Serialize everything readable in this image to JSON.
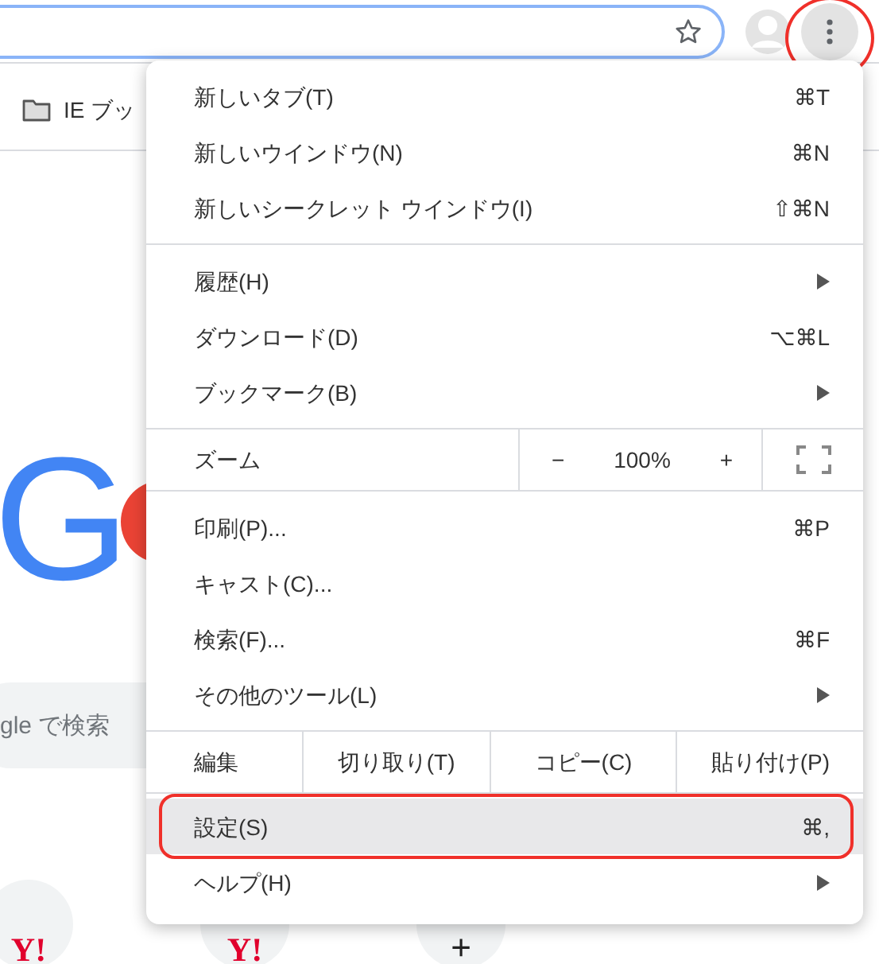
{
  "toolbar": {
    "menu_button": {
      "callout": true
    }
  },
  "bookmarks": [
    {
      "label": "IE ブッ"
    }
  ],
  "logo": {
    "text": "G"
  },
  "search": {
    "placeholder": "gle で検索"
  },
  "shortcuts": [
    {
      "kind": "site",
      "label": "Y!"
    },
    {
      "kind": "site",
      "label": "Y!"
    },
    {
      "kind": "add",
      "label": "+"
    }
  ],
  "menu": {
    "sections": [
      {
        "kind": "items",
        "items": [
          {
            "label": "新しいタブ(T)",
            "shortcut": "⌘T",
            "submenu": false,
            "selected": false,
            "callout": false
          },
          {
            "label": "新しいウインドウ(N)",
            "shortcut": "⌘N",
            "submenu": false,
            "selected": false,
            "callout": false
          },
          {
            "label": "新しいシークレット ウインドウ(I)",
            "shortcut": "⇧⌘N",
            "submenu": false,
            "selected": false,
            "callout": false
          }
        ]
      },
      {
        "kind": "items",
        "items": [
          {
            "label": "履歴(H)",
            "submenu": true,
            "selected": false,
            "callout": false
          },
          {
            "label": "ダウンロード(D)",
            "shortcut": "⌥⌘L",
            "submenu": false,
            "selected": false,
            "callout": false
          },
          {
            "label": "ブックマーク(B)",
            "submenu": true,
            "selected": false,
            "callout": false
          }
        ]
      },
      {
        "kind": "zoom",
        "label": "ズーム",
        "minus": "−",
        "value": "100%",
        "plus": "+"
      },
      {
        "kind": "items",
        "items": [
          {
            "label": "印刷(P)...",
            "shortcut": "⌘P",
            "submenu": false,
            "selected": false,
            "callout": false
          },
          {
            "label": "キャスト(C)...",
            "submenu": false,
            "selected": false,
            "callout": false
          },
          {
            "label": "検索(F)...",
            "shortcut": "⌘F",
            "submenu": false,
            "selected": false,
            "callout": false
          },
          {
            "label": "その他のツール(L)",
            "submenu": true,
            "selected": false,
            "callout": false
          }
        ]
      },
      {
        "kind": "edit",
        "label": "編集",
        "buttons": [
          "切り取り(T)",
          "コピー(C)",
          "貼り付け(P)"
        ]
      },
      {
        "kind": "items",
        "items": [
          {
            "label": "設定(S)",
            "shortcut": "⌘,",
            "submenu": false,
            "selected": true,
            "callout": true
          },
          {
            "label": "ヘルプ(H)",
            "submenu": true,
            "selected": false,
            "callout": false
          }
        ]
      }
    ]
  }
}
